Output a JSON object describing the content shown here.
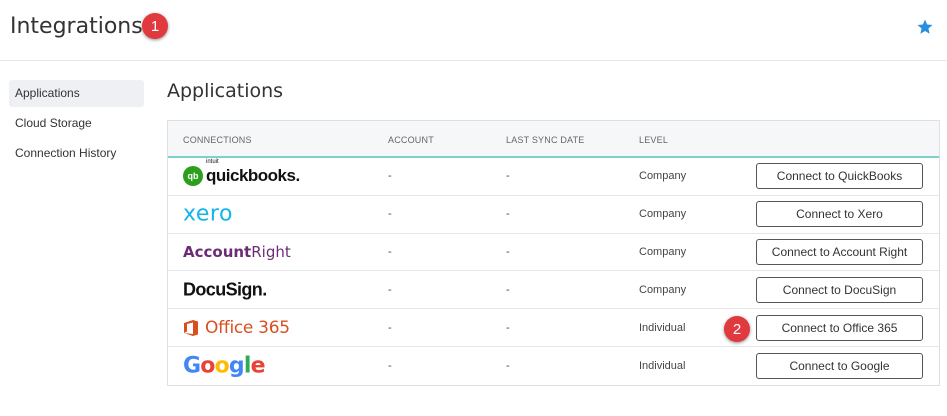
{
  "header": {
    "title": "Integrations",
    "callout_1": "1",
    "favorite_icon": "star-icon",
    "star_color": "#2a8de0"
  },
  "sidebar": {
    "items": [
      {
        "label": "Applications",
        "active": true
      },
      {
        "label": "Cloud Storage",
        "active": false
      },
      {
        "label": "Connection History",
        "active": false
      }
    ]
  },
  "main": {
    "section_title": "Applications",
    "columns": [
      "CONNECTIONS",
      "ACCOUNT",
      "LAST SYNC DATE",
      "LEVEL"
    ],
    "rows": [
      {
        "logo": {
          "intuit": "intuit",
          "mark": "qb",
          "name": "quickbooks."
        },
        "account": "-",
        "last_sync": "-",
        "level": "Company",
        "button": "Connect to QuickBooks"
      },
      {
        "logo": {
          "name": "xero"
        },
        "account": "-",
        "last_sync": "-",
        "level": "Company",
        "button": "Connect to Xero"
      },
      {
        "logo": {
          "part1": "Account",
          "part2": "Right"
        },
        "account": "-",
        "last_sync": "-",
        "level": "Company",
        "button": "Connect to Account Right"
      },
      {
        "logo": {
          "name": "DocuSign."
        },
        "account": "-",
        "last_sync": "-",
        "level": "Company",
        "button": "Connect to DocuSign"
      },
      {
        "logo": {
          "name": "Office 365"
        },
        "account": "-",
        "last_sync": "-",
        "level": "Individual",
        "button": "Connect to Office 365"
      },
      {
        "logo": {
          "name": "Google"
        },
        "account": "-",
        "last_sync": "-",
        "level": "Individual",
        "button": "Connect to Google"
      }
    ],
    "callout_2": "2"
  },
  "colors": {
    "accent_teal": "#7fcfcf",
    "callout_red": "#e0393e",
    "quickbooks_green": "#2ca01c",
    "xero_blue": "#13b5ea",
    "accountright_purple": "#6b2c75",
    "office_orange": "#d85020"
  }
}
